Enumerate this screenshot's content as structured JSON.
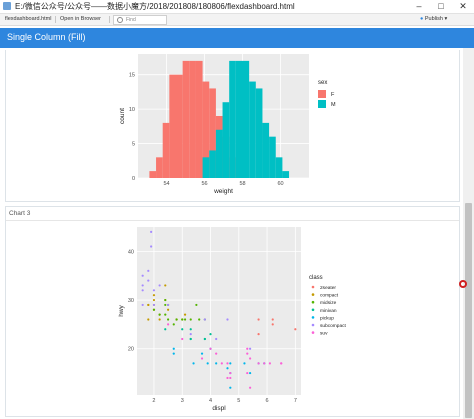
{
  "window": {
    "title": "E:/微信公众号/公众号——数据小魔方/2018/201808/180806/flexdashboard.html"
  },
  "toolbar": {
    "file_label": "flexdashboard.html",
    "open_label": "Open in Browser",
    "find_placeholder": "Find",
    "publish_label": "Publish"
  },
  "dashboard": {
    "title": "Single Column (Fill)"
  },
  "chart2": {
    "panel_title": ""
  },
  "chart3": {
    "panel_title": "Chart 3"
  },
  "colors": {
    "accent": "#2e86de",
    "female": "#f8766d",
    "male": "#00bfc4"
  },
  "chart_data": [
    {
      "type": "bar",
      "subtype": "histogram",
      "xlabel": "weight",
      "ylabel": "count",
      "x_ticks": [
        "54",
        "56",
        "58",
        "60"
      ],
      "y_ticks": [
        "0",
        "5",
        "10",
        "15"
      ],
      "xlim": [
        52.5,
        61.5
      ],
      "ylim": [
        0,
        18
      ],
      "legend_title": "sex",
      "legend_position": "right",
      "bin_width": 0.35,
      "series": [
        {
          "name": "F",
          "color": "#f8766d",
          "bins": [
            [
              53.1,
              1
            ],
            [
              53.45,
              3
            ],
            [
              53.8,
              8
            ],
            [
              54.15,
              15
            ],
            [
              54.5,
              15
            ],
            [
              54.85,
              17
            ],
            [
              55.2,
              17
            ],
            [
              55.55,
              17
            ],
            [
              55.9,
              14
            ],
            [
              56.25,
              13
            ],
            [
              56.6,
              9
            ],
            [
              56.95,
              6
            ],
            [
              57.3,
              3
            ]
          ]
        },
        {
          "name": "M",
          "color": "#00bfc4",
          "bins": [
            [
              55.9,
              3
            ],
            [
              56.25,
              4
            ],
            [
              56.6,
              7
            ],
            [
              56.95,
              11
            ],
            [
              57.3,
              17
            ],
            [
              57.65,
              17
            ],
            [
              58.0,
              17
            ],
            [
              58.35,
              14
            ],
            [
              58.7,
              13
            ],
            [
              59.05,
              8
            ],
            [
              59.4,
              6
            ],
            [
              59.75,
              3
            ],
            [
              60.1,
              1
            ]
          ]
        }
      ]
    },
    {
      "type": "scatter",
      "xlabel": "displ",
      "ylabel": "hwy",
      "x_ticks": [
        "2",
        "3",
        "4",
        "5",
        "6",
        "7"
      ],
      "y_ticks": [
        "20",
        "30",
        "40"
      ],
      "xlim": [
        1.4,
        7.2
      ],
      "ylim": [
        10.5,
        45
      ],
      "legend_title": "class",
      "legend_position": "right",
      "classes": [
        {
          "name": "2seater",
          "color": "#f8766d",
          "points": [
            [
              5.7,
              26
            ],
            [
              5.7,
              23
            ],
            [
              6.2,
              26
            ],
            [
              6.2,
              25
            ],
            [
              7.0,
              24
            ]
          ]
        },
        {
          "name": "compact",
          "color": "#c49a00",
          "points": [
            [
              1.8,
              29
            ],
            [
              1.8,
              29
            ],
            [
              2.0,
              31
            ],
            [
              2.0,
              30
            ],
            [
              2.8,
              26
            ],
            [
              2.8,
              26
            ],
            [
              3.1,
              27
            ],
            [
              1.8,
              26
            ],
            [
              2.0,
              28
            ],
            [
              2.2,
              27
            ],
            [
              2.4,
              30
            ],
            [
              2.4,
              33
            ],
            [
              3.0,
              26
            ],
            [
              2.2,
              26
            ],
            [
              2.0,
              29
            ],
            [
              2.5,
              28
            ]
          ]
        },
        {
          "name": "midsize",
          "color": "#53b400",
          "points": [
            [
              2.4,
              27
            ],
            [
              2.4,
              30
            ],
            [
              3.1,
              26
            ],
            [
              3.5,
              29
            ],
            [
              3.6,
              26
            ],
            [
              2.5,
              26
            ],
            [
              2.5,
              29
            ],
            [
              3.0,
              26
            ],
            [
              3.3,
              26
            ],
            [
              2.8,
              26
            ],
            [
              3.8,
              26
            ],
            [
              2.2,
              27
            ],
            [
              2.7,
              25
            ],
            [
              2.0,
              28
            ],
            [
              2.4,
              29
            ]
          ]
        },
        {
          "name": "minivan",
          "color": "#00c094",
          "points": [
            [
              2.4,
              24
            ],
            [
              3.0,
              24
            ],
            [
              3.3,
              22
            ],
            [
              3.3,
              22
            ],
            [
              3.3,
              24
            ],
            [
              3.8,
              22
            ],
            [
              3.8,
              22
            ],
            [
              4.0,
              23
            ]
          ]
        },
        {
          "name": "pickup",
          "color": "#00b6eb",
          "points": [
            [
              2.7,
              20
            ],
            [
              2.7,
              19
            ],
            [
              3.7,
              19
            ],
            [
              3.9,
              17
            ],
            [
              4.7,
              17
            ],
            [
              4.7,
              15
            ],
            [
              5.2,
              17
            ],
            [
              5.7,
              17
            ],
            [
              5.9,
              17
            ],
            [
              4.7,
              12
            ],
            [
              4.6,
              16
            ],
            [
              5.4,
              15
            ],
            [
              4.0,
              20
            ],
            [
              3.4,
              17
            ],
            [
              4.2,
              17
            ]
          ]
        },
        {
          "name": "subcompact",
          "color": "#a58aff",
          "points": [
            [
              1.6,
              33
            ],
            [
              1.6,
              32
            ],
            [
              1.8,
              36
            ],
            [
              1.9,
              44
            ],
            [
              1.9,
              41
            ],
            [
              1.8,
              34
            ],
            [
              2.0,
              29
            ],
            [
              1.6,
              35
            ],
            [
              2.5,
              29
            ],
            [
              3.8,
              26
            ],
            [
              4.6,
              26
            ],
            [
              5.4,
              20
            ],
            [
              2.0,
              32
            ],
            [
              2.2,
              33
            ],
            [
              1.6,
              29
            ],
            [
              3.3,
              23
            ],
            [
              4.2,
              22
            ]
          ]
        },
        {
          "name": "suv",
          "color": "#fb61d7",
          "points": [
            [
              5.3,
              20
            ],
            [
              5.3,
              15
            ],
            [
              5.7,
              17
            ],
            [
              6.5,
              17
            ],
            [
              4.0,
              20
            ],
            [
              4.2,
              19
            ],
            [
              4.6,
              17
            ],
            [
              5.4,
              18
            ],
            [
              4.7,
              14
            ],
            [
              5.9,
              17
            ],
            [
              3.0,
              22
            ],
            [
              3.7,
              18
            ],
            [
              4.4,
              17
            ],
            [
              2.5,
              25
            ],
            [
              4.7,
              15
            ],
            [
              6.1,
              17
            ],
            [
              5.3,
              19
            ],
            [
              4.6,
              14
            ],
            [
              5.4,
              12
            ],
            [
              6.5,
              17
            ]
          ]
        }
      ]
    }
  ]
}
